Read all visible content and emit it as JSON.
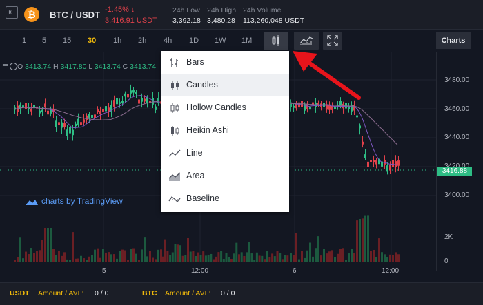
{
  "header": {
    "collapse_icon": "collapse-left-icon",
    "coin_glyph": "₿",
    "pair": "BTC / USDT",
    "change": "-1.45%  ↓",
    "price": "3,416.91 USDT",
    "stats": [
      {
        "label": "24h Low",
        "value": "3,392.18"
      },
      {
        "label": "24h High",
        "value": "3,480.28"
      },
      {
        "label": "24h Volume",
        "value": "113,260,048 USDT"
      }
    ]
  },
  "toolbar": {
    "intervals": [
      "1",
      "5",
      "15",
      "30",
      "1h",
      "2h",
      "4h",
      "1D",
      "1W",
      "1M"
    ],
    "active_interval": "30",
    "charts_label": "Charts"
  },
  "legend": {
    "o_label": "O",
    "o": "3413.74",
    "h_label": "H",
    "h": "3417.80",
    "l_label": "L",
    "l": "3413.74",
    "c_label": "C",
    "c": "3413.74"
  },
  "watermark": "charts by TradingView",
  "chart_type_menu": {
    "items": [
      {
        "label": "Bars",
        "icon": "bars-icon"
      },
      {
        "label": "Candles",
        "icon": "candles-icon"
      },
      {
        "label": "Hollow Candles",
        "icon": "hollow-candles-icon"
      },
      {
        "label": "Heikin Ashi",
        "icon": "heikin-ashi-icon"
      },
      {
        "label": "Line",
        "icon": "line-icon"
      },
      {
        "label": "Area",
        "icon": "area-icon"
      },
      {
        "label": "Baseline",
        "icon": "baseline-icon"
      }
    ],
    "highlighted": "Candles"
  },
  "price_axis": {
    "ticks": [
      "3480.00",
      "3460.00",
      "3440.00",
      "3420.00",
      "3400.00"
    ],
    "current_price": "3416.88"
  },
  "volume_axis": {
    "ticks": [
      "2K",
      "0"
    ]
  },
  "time_axis": {
    "ticks": [
      "5",
      "12:00",
      "6",
      "12:00"
    ]
  },
  "footer": {
    "left_currency": "USDT",
    "left_label": "Amount / AVL:",
    "left_value": "0 / 0",
    "right_currency": "BTC",
    "right_label": "Amount / AVL:",
    "right_value": "0 / 0"
  },
  "colors": {
    "up": "#2ebd85",
    "down": "#e0414a",
    "accent": "#f0b90b",
    "annotation_arrow": "#e8141b"
  }
}
